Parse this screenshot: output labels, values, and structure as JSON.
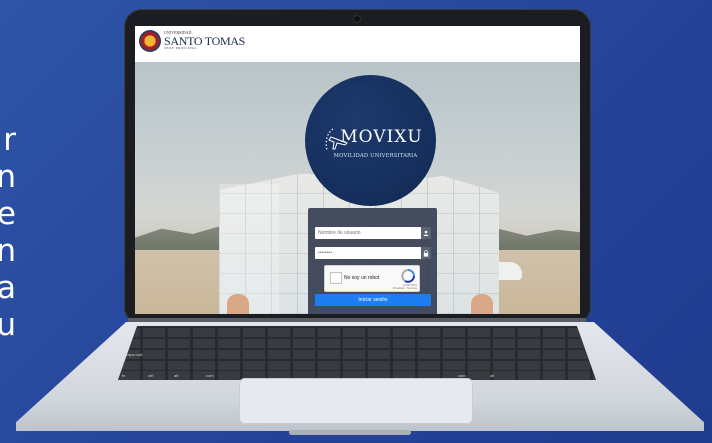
{
  "side_letters": [
    "r",
    "n",
    "e",
    "n",
    "a",
    "u"
  ],
  "site": {
    "logo_small": "UNIVERSIDAD",
    "logo_main": "SANTO TOMAS",
    "logo_sub": "SEDE PRINCIPAL"
  },
  "hero": {
    "brand": "MOVIXU",
    "tagline": "MOVILIDAD UNIVERSITARIA"
  },
  "login": {
    "username_placeholder": "Nombre de usuario",
    "password_value": "••••••••",
    "captcha_label": "No soy un robot",
    "captcha_footer": "reCAPTCHA",
    "captcha_terms": "Privacidad - Términos",
    "submit_label": "Iniciar sesión"
  },
  "keyboard": {
    "caps_label": "caps lock",
    "fn_label": "fn",
    "ctrl_label": "ctrl",
    "opt_label": "alt",
    "cmd_label": "com",
    "cmd_right_label": "com",
    "alt_right_label": "alt"
  },
  "colors": {
    "background": "#2a4aa0",
    "circle": "#16305e",
    "button": "#1c7ef0"
  },
  "icons": {
    "user": "user-icon",
    "lock": "lock-icon",
    "plane": "airplane-icon",
    "recaptcha": "recaptcha-icon"
  }
}
